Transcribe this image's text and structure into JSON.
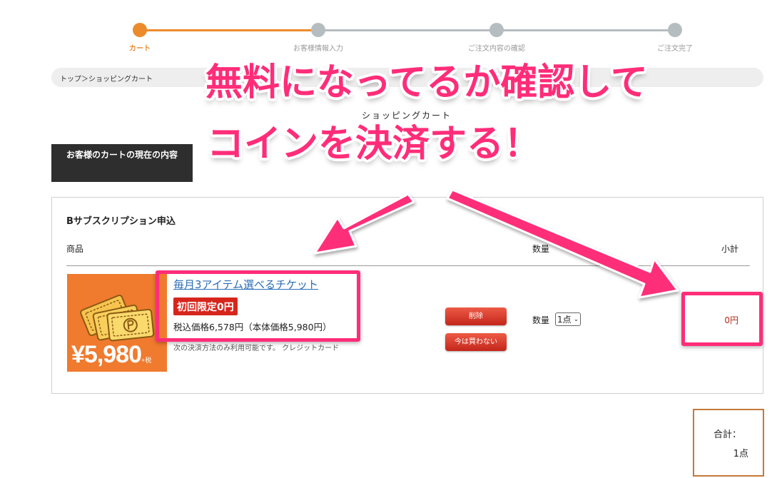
{
  "steps": [
    {
      "label": "カート",
      "active": true
    },
    {
      "label": "お客様情報入力",
      "active": false
    },
    {
      "label": "ご注文内容の確認",
      "active": false
    },
    {
      "label": "ご注文完了",
      "active": false
    }
  ],
  "colors": {
    "step_active": "#ec8b2c",
    "step_inactive": "#b6bdc1",
    "annotation": "#ff2d79",
    "badge_red": "#d6261c"
  },
  "breadcrumb": "トップ＞ショッピングカート",
  "cart_heading": "ショッピングカート",
  "section_title": "お客様のカートの現在の内容",
  "cart": {
    "group_title": "Bサブスクリプション申込",
    "columns": {
      "product": "商品",
      "qty": "数量",
      "subtotal": "小計"
    },
    "item": {
      "image_price": "¥5,980",
      "image_tax": "+税",
      "name": "毎月3アイテム選べるチケット",
      "badge": "初回限定0円",
      "price_line": "税込価格6,578円（本体価格5,980円）",
      "payment_note": "次の決済方法のみ利用可能です。 クレジットカード",
      "delete_button": "削除",
      "later_button": "今は買わない",
      "qty_label": "数量",
      "qty_value": "1点",
      "subtotal": "0円"
    }
  },
  "total": {
    "label": "合計：",
    "value": "1点"
  },
  "annotation": {
    "line1": "無料になってるか確認して",
    "line2": "コインを決済する！"
  }
}
